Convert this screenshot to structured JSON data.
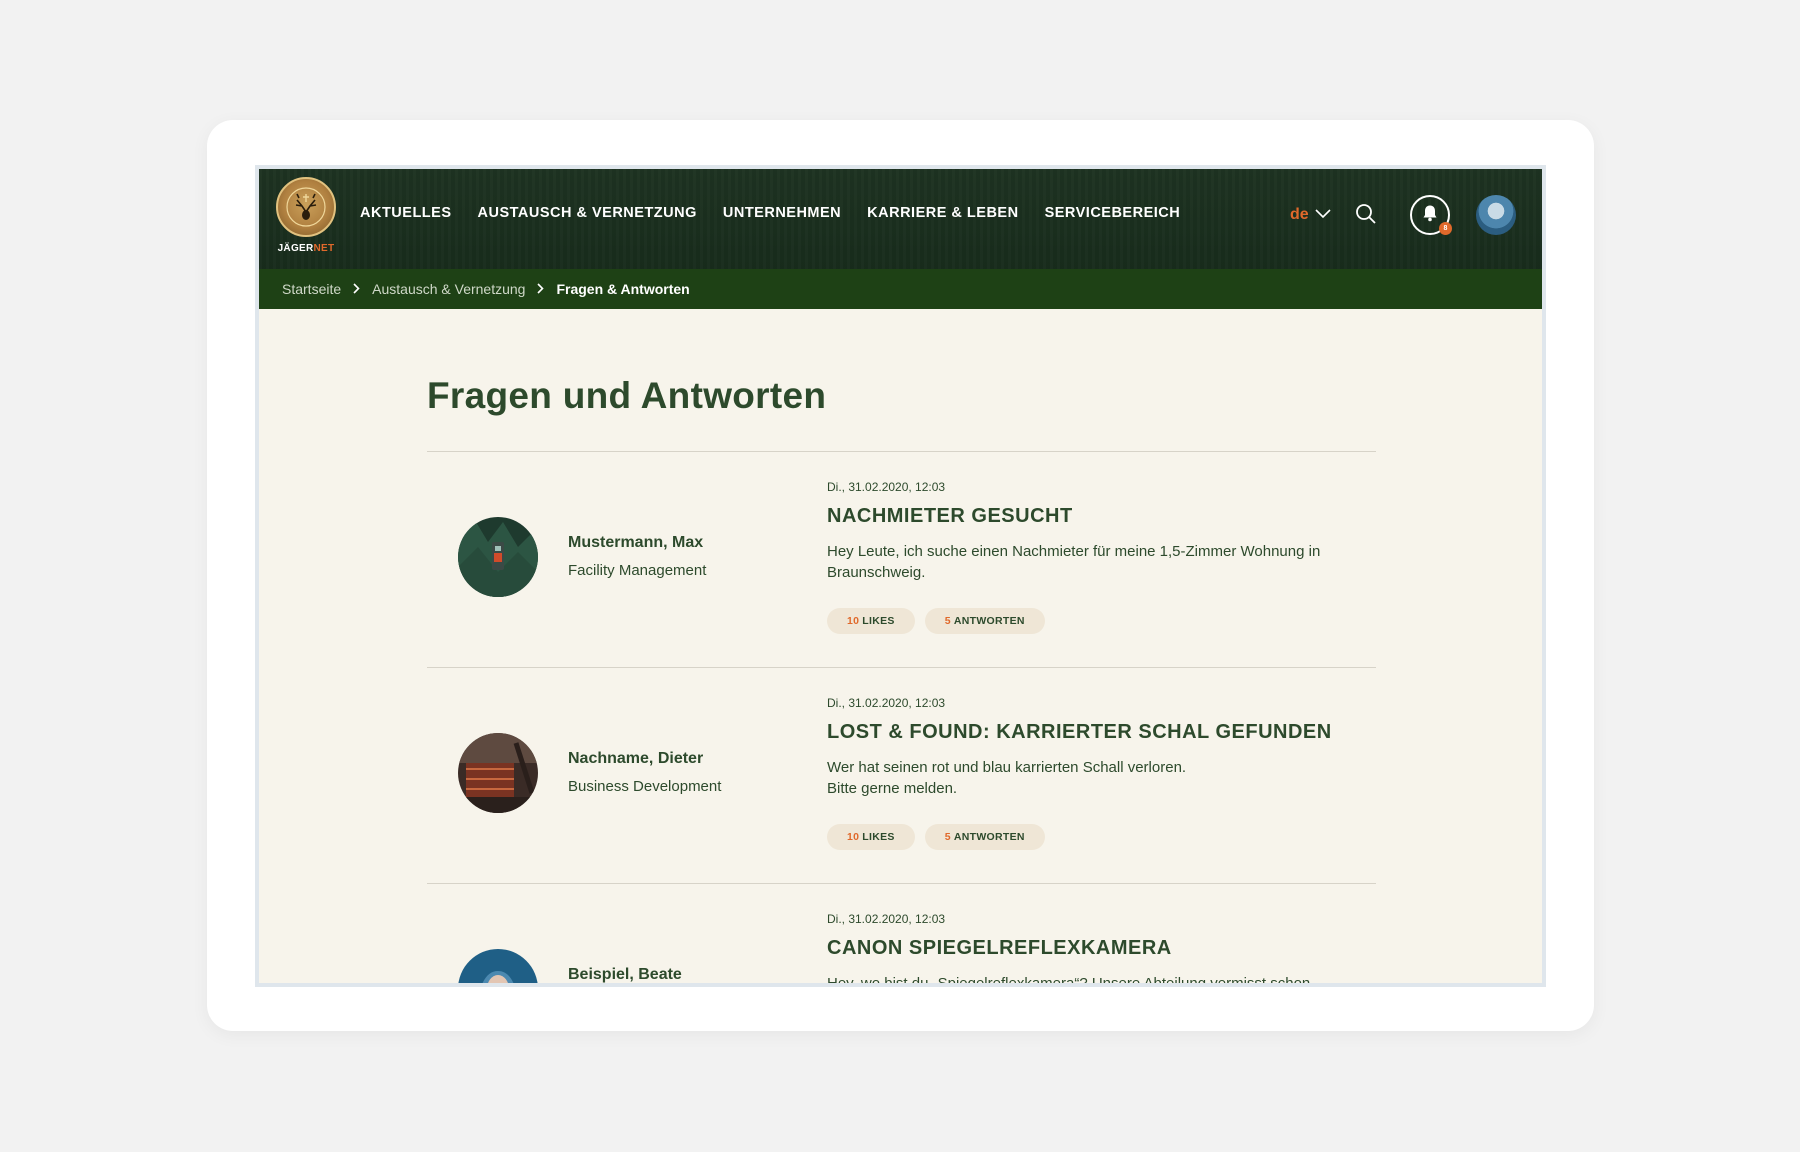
{
  "brand": {
    "logo_text": "JÄGER",
    "logo_text_accent": "NET"
  },
  "nav": {
    "items": [
      "AKTUELLES",
      "AUSTAUSCH & VERNETZUNG",
      "UNTERNEHMEN",
      "KARRIERE & LEBEN",
      "SERVICEBEREICH"
    ],
    "language": "de",
    "notification_count": "8"
  },
  "breadcrumb": [
    "Startseite",
    "Austausch & Vernetzung",
    "Fragen & Antworten"
  ],
  "page": {
    "title": "Fragen und Antworten"
  },
  "posts": [
    {
      "author": "Mustermann, Max",
      "department": "Facility Management",
      "date": "Di., 31.02.2020, 12:03",
      "title": "NACHMIETER GESUCHT",
      "text_lines": [
        "Hey Leute, ich suche einen Nachmieter für meine 1,5-Zimmer Wohnung in",
        "Braunschweig."
      ],
      "likes": "10",
      "likes_label": "LIKES",
      "answers": "5",
      "answers_label": "ANTWORTEN"
    },
    {
      "author": "Nachname, Dieter",
      "department": "Business Development",
      "date": "Di., 31.02.2020, 12:03",
      "title": "LOST & FOUND: KARRIERTER SCHAL GEFUNDEN",
      "text_lines": [
        "Wer hat seinen rot und blau karrierten Schall verloren.",
        "Bitte gerne melden."
      ],
      "likes": "10",
      "likes_label": "LIKES",
      "answers": "5",
      "answers_label": "ANTWORTEN"
    },
    {
      "author": "Beispiel, Beate",
      "department": "",
      "date": "Di., 31.02.2020, 12:03",
      "title": "CANON SPIEGELREFLEXKAMERA",
      "text_lines": [
        "Hey, wo bist du „Spiegelreflexkamera“? Unsere Abteilung vermisst schon",
        ""
      ],
      "likes": "",
      "likes_label": "",
      "answers": "",
      "answers_label": ""
    }
  ],
  "colors": {
    "header_bg": "#1c3120",
    "breadcrumb_bg": "#1e4115",
    "page_bg": "#f7f4eb",
    "text_green": "#2d4a2c",
    "accent_orange": "#e0692b",
    "pill_bg": "#efe6d6"
  }
}
